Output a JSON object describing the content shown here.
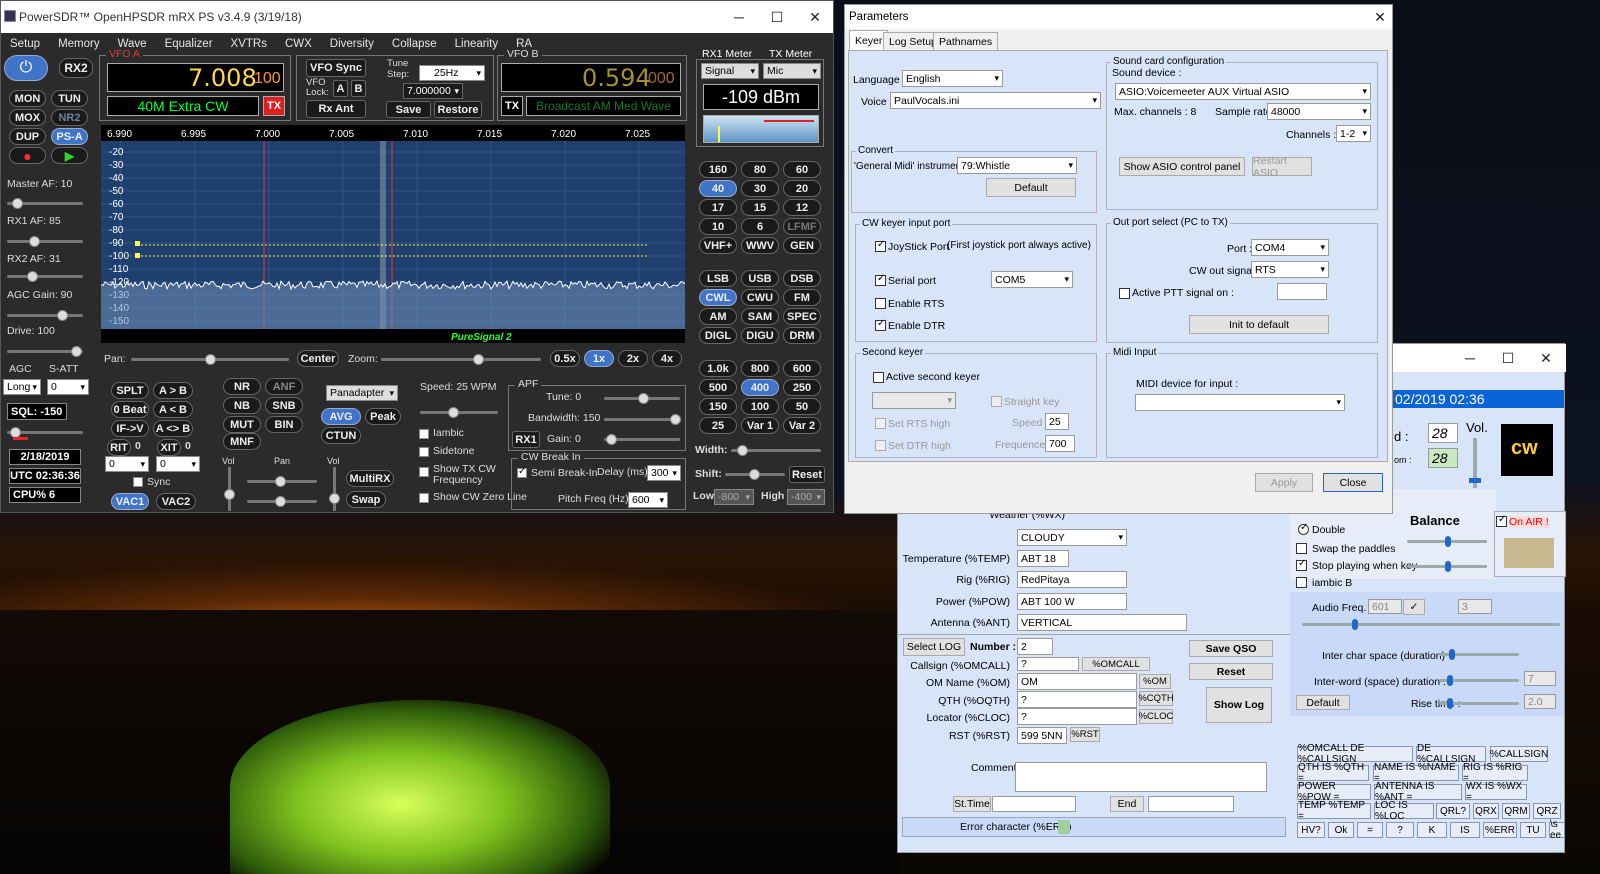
{
  "psdr": {
    "title": "PowerSDR™ OpenHPSDR mRX PS v3.4.9 (3/19/18)",
    "menu": [
      "Setup",
      "Memory",
      "Wave",
      "Equalizer",
      "XVTRs",
      "CWX",
      "Diversity",
      "Collapse",
      "Linearity",
      "RA"
    ],
    "rx2": "RX2",
    "left_buttons": [
      "MON",
      "TUN",
      "MOX",
      "NR2",
      "DUP",
      "PS-A"
    ],
    "master_af": "Master AF:  10",
    "rx1_af": "RX1 AF:  85",
    "rx2_af": "RX2 AF:  31",
    "agc_gain": "AGC Gain:  90",
    "drive": "Drive:  100",
    "agc": "AGC",
    "satt": "S-ATT",
    "agc_mode": "Long",
    "satt_val": "0",
    "sql": "SQL:  -150",
    "date": "2/18/2019",
    "utc": "UTC 02:36:36",
    "cpu": "CPU%  6",
    "vfoa": {
      "label": "VFO A",
      "freq": "7.008",
      "sub": "100",
      "band": "40M Extra CW",
      "tx": "TX"
    },
    "vfob": {
      "label": "VFO B",
      "freq": "0.594",
      "sub": "000",
      "band": "Broadcast AM Med Wave",
      "tx": "TX"
    },
    "vfosync": "VFO Sync",
    "vfolock": "VFO Lock:",
    "lock_a": "A",
    "lock_b": "B",
    "rxant": "Rx Ant",
    "tunestep": "Tune Step:",
    "step_val": "25Hz",
    "step_freq": "7.000000",
    "save": "Save",
    "restore": "Restore",
    "rx1meter": "RX1 Meter",
    "txmeter": "TX Meter",
    "meter_rx": "Signal",
    "meter_tx": "Mic",
    "dbm": "-109 dBm",
    "scale_top": [
      "6.990",
      "6.995",
      "7.000",
      "7.005",
      "7.010",
      "7.015",
      "7.020",
      "7.025"
    ],
    "scale_db": [
      "-20",
      "-30",
      "-40",
      "-50",
      "-60",
      "-70",
      "-80",
      "-90",
      "-100",
      "-110",
      "-120",
      "-130",
      "-140",
      "-150"
    ],
    "puresignal": "PureSignal 2",
    "pan": "Pan:",
    "center": "Center",
    "zoom": "Zoom:",
    "zooms": [
      "0.5x",
      "1x",
      "2x",
      "4x"
    ],
    "bands": [
      "160",
      "80",
      "60",
      "40",
      "30",
      "20",
      "17",
      "15",
      "12",
      "10",
      "6",
      "LFMF",
      "VHF+",
      "WWV",
      "GEN"
    ],
    "modes": [
      "LSB",
      "USB",
      "DSB",
      "CWL",
      "CWU",
      "FM",
      "AM",
      "SAM",
      "SPEC",
      "DIGL",
      "DIGU",
      "DRM"
    ],
    "filters": [
      "1.0k",
      "800",
      "600",
      "500",
      "400",
      "250",
      "150",
      "100",
      "50",
      "25",
      "Var 1",
      "Var 2"
    ],
    "splt": "SPLT",
    "atob": "A > B",
    "zerobeat": "0 Beat",
    "aob": "A < B",
    "ifv": "IF->V",
    "aswap": "A <> B",
    "rit": "RIT",
    "rit_n": "0",
    "xit": "XIT",
    "xit_n": "0",
    "rit_v": "0",
    "xit_v": "0",
    "sync": "Sync",
    "vac1": "VAC1",
    "vac2": "VAC2",
    "dsp": [
      "NR",
      "ANF",
      "NB",
      "SNB",
      "MUT",
      "BIN",
      "MNF"
    ],
    "display_mode": "Panadapter",
    "avg": "AVG",
    "peak": "Peak",
    "ctun": "CTUN",
    "vol": "Vol",
    "pan2": "Pan",
    "multirx": "MultiRX",
    "swap": "Swap",
    "speed": "Speed:  25 WPM",
    "iambic": "Iambic",
    "sidetone": "Sidetone",
    "show_tx": "Show TX CW Frequency",
    "show_zero": "Show CW Zero Line",
    "apf": "APF",
    "tune": "Tune:  0",
    "bandwidth": "Bandwidth:  150",
    "rx1": "RX1",
    "gain": "Gain:  0",
    "cwbreak": "CW Break In",
    "semi": "Semi Break-In",
    "delay": "Delay (ms):",
    "delay_v": "300",
    "pitch": "Pitch Freq (Hz):",
    "pitch_v": "600",
    "width": "Width:",
    "shift": "Shift:",
    "reset": "Reset",
    "low": "Low",
    "low_v": "-800",
    "high": "High",
    "high_v": "-400"
  },
  "param": {
    "title": "Parameters",
    "tabs": [
      "Keyer",
      "Log Setup",
      "Pathnames"
    ],
    "language_lbl": "Language :",
    "language": "English",
    "voice_lbl": "Voice",
    "voice": "PaulVocals.ini",
    "convert": "Convert",
    "midi_lbl": "'General Midi' instrument :",
    "midi": "79:Whistle",
    "default": "Default",
    "cw_port": "CW keyer input port",
    "joystick": "JoyStick Port",
    "joystick_note": "(First joystick port always active)",
    "serial": "Serial port",
    "serial_val": "COM5",
    "rts": "Enable RTS",
    "dtr": "Enable DTR",
    "second": "Second keyer",
    "active_second": "Active second keyer",
    "straight": "Straight key",
    "set_rts": "Set RTS high",
    "set_dtr": "Set DTR high",
    "speed": "Speed :",
    "speed_v": "25",
    "freq": "Frequence",
    "freq_v": "700",
    "sound": "Sound card configuration",
    "sound_dev": "Sound device :",
    "sound_val": "ASIO:Voicemeeter AUX Virtual ASIO",
    "maxch": "Max. channels : 8",
    "rate_lbl": "Sample rate :",
    "rate": "48000",
    "ch_lbl": "Channels :",
    "ch": "1-2",
    "show_asio": "Show ASIO control panel",
    "restart_asio": "Restart ASIO",
    "out": "Out port select (PC to TX)",
    "port_lbl": "Port :",
    "port": "COM4",
    "cwout_lbl": "CW out signal :",
    "cwout": "RTS",
    "ptt": "Active PTT signal on :",
    "init": "Init to default",
    "midi_in": "Midi Input",
    "midi_dev": "MIDI device for input :",
    "apply": "Apply",
    "close": "Close"
  },
  "cw": {
    "datetime": "02/2019 02:36",
    "n1": "28",
    "n2": "28",
    "d_lbl": "d :",
    "om_lbl": "om :",
    "vol": "Vol.",
    "balance": "Balance",
    "onair": "On AIR !",
    "weather_lbl": "Weather (%WX)",
    "weather": "CLOUDY",
    "temp_lbl": "Temperature (%TEMP)",
    "temp": "ABT 18",
    "rig_lbl": "Rig (%RIG)",
    "rig": "RedPitaya",
    "pow_lbl": "Power (%POW)",
    "pow": "ABT 100 W",
    "ant_lbl": "Antenna (%ANT)",
    "ant": "VERTICAL",
    "selectlog": "Select LOG",
    "number_lbl": "Number :",
    "number": "2",
    "call_lbl": "Callsign  (%OMCALL)",
    "call": "?",
    "omcall": "%OMCALL",
    "omname_lbl": "OM Name (%OM)",
    "omname": "OM",
    "om_btn": "%OM",
    "qth_lbl": "QTH (%OQTH)",
    "qth": "?",
    "qth_btn": "%CQTH",
    "loc_lbl": "Locator (%CLOC)",
    "loc": "?",
    "loc_btn": "%CLOC",
    "rst_lbl": "RST (%RST)",
    "rst": "599 5NN",
    "rst_btn": "%RST",
    "saveqso": "Save QSO",
    "reset": "Reset",
    "showlog": "Show Log",
    "comments": "Comments",
    "sttime": "St.Time",
    "end": "End",
    "err": "Error character (%ERR)",
    "double": "Double",
    "swap_paddles": "Swap the paddles",
    "stop_playing": "Stop playing when key",
    "iambic_b": "iambic B",
    "audio_freq": "Audio Freq.",
    "audio_v": "601",
    "audio_n": "3",
    "inter_char": "Inter char space (duration)",
    "inter_word": "Inter-word (space) duration :",
    "inter_word_v": "7",
    "default": "Default",
    "rise": "Rise time :",
    "rise_v": "2.0",
    "macros": [
      "%OMCALL DE %CALLSIGN",
      "DE %CALLSIGN",
      "%CALLSIGN",
      "QTH IS %QTH =",
      "NAME IS %NAME =",
      "RIG IS %RIG =",
      "POWER %POW =",
      "ANTENNA IS %ANT =",
      "WX IS %WX =",
      "TEMP %TEMP =",
      "LOC IS %LOC",
      "QRL?",
      "QRX",
      "QRM",
      "QRZ",
      "HV?",
      "Ok",
      "=",
      "?",
      "K",
      "IS",
      "%ERR",
      "TU",
      "\\s ee"
    ]
  },
  "colors": {
    "accent": "#3f74c8",
    "vfo_yellow": "#ffd84a",
    "vfo_green": "#00ff3a",
    "spectrum_bg": "#1f3f6e"
  }
}
